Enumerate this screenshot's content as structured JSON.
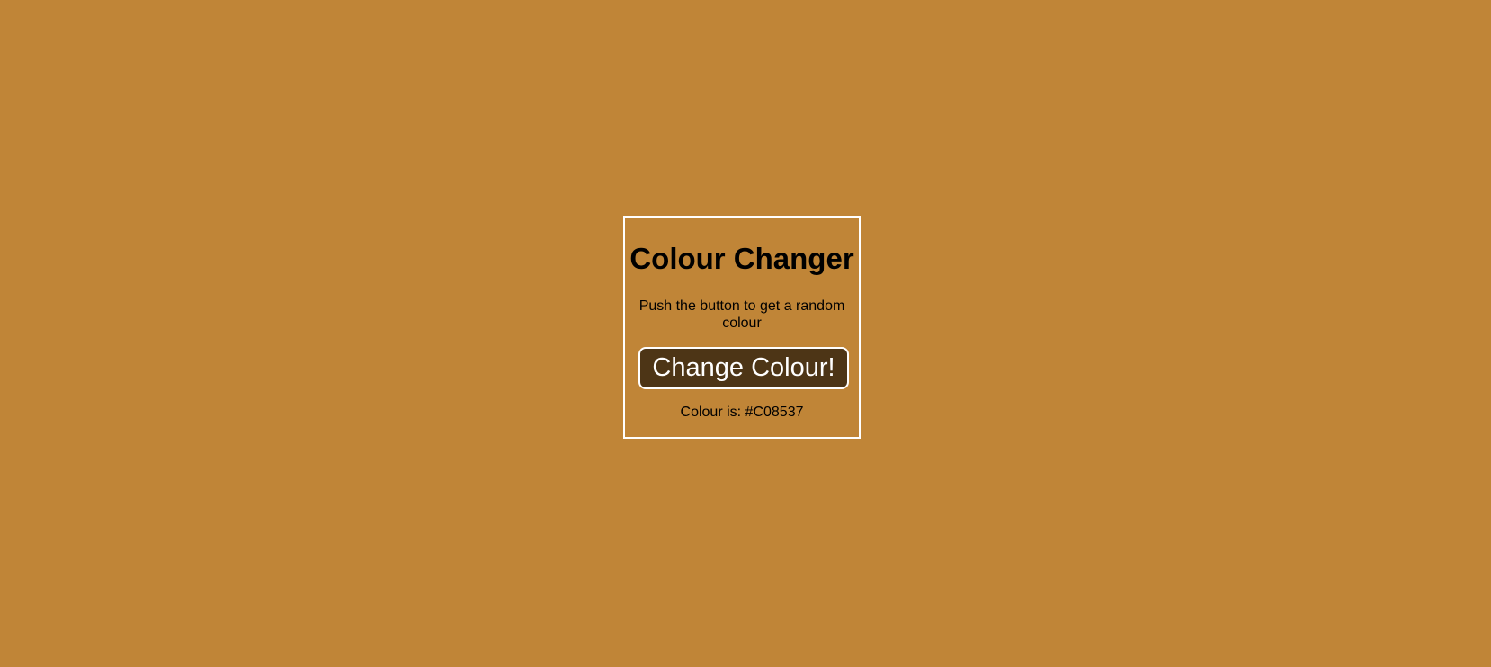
{
  "page": {
    "background_color": "#C08537"
  },
  "card": {
    "title": "Colour Changer",
    "description": "Push the button to get a random colour",
    "button_label": "Change Colour!",
    "button_color": "#4D3516",
    "colour_readout": "Colour is: #C08537"
  }
}
